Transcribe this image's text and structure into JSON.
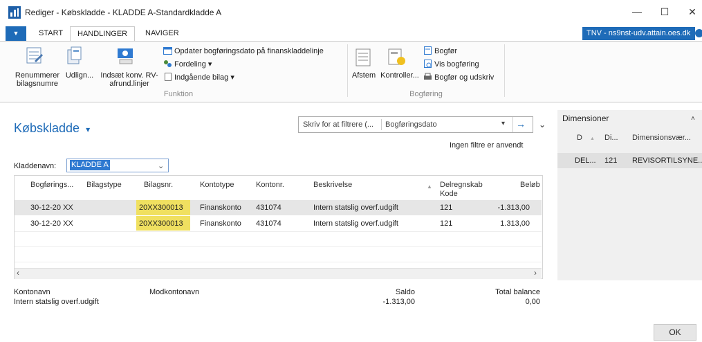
{
  "window": {
    "title": "Rediger - Købskladde - KLADDE A-Standardkladde A",
    "minimize": "—",
    "maximize": "☐",
    "close": "✕"
  },
  "ribbon": {
    "menu_icon": "▼",
    "tabs": [
      "START",
      "HANDLINGER",
      "NAVIGER"
    ],
    "server": "TNV - ns9nst-udv.attain.oes.dk",
    "funktion": {
      "label": "Funktion",
      "large_buttons": [
        {
          "label": "Renummerer bilagsnumre",
          "icon": "renumber-icon"
        },
        {
          "label": "Udlign...",
          "icon": "apply-entries-icon"
        },
        {
          "label": "Indsæt konv. RV-afrund.linjer",
          "icon": "insert-rounding-icon"
        }
      ],
      "small_buttons": [
        {
          "label": "Opdater bogføringsdato på finanskladdelinje",
          "icon": "update-date-icon"
        },
        {
          "label": "Fordeling ▾",
          "icon": "allocation-icon"
        },
        {
          "label": "Indgående bilag ▾",
          "icon": "incoming-document-icon"
        }
      ]
    },
    "bogforing": {
      "label": "Bogføring",
      "large_buttons": [
        {
          "label": "Afstem",
          "icon": "reconcile-icon"
        },
        {
          "label": "Kontroller...",
          "icon": "check-icon"
        }
      ],
      "small_buttons": [
        {
          "label": "Bogfør",
          "icon": "post-icon"
        },
        {
          "label": "Vis bogføring",
          "icon": "preview-posting-icon"
        },
        {
          "label": "Bogfør og udskriv",
          "icon": "post-print-icon"
        }
      ]
    }
  },
  "page": {
    "title": "Købskladde",
    "title_caret": "▾",
    "filter": {
      "placeholder": "Skriv for at filtrere (...",
      "field": "Bogføringsdato"
    },
    "no_filter": "Ingen filtre er anvendt",
    "kladdenavn_label": "Kladdenavn:",
    "kladdenavn_value": "KLADDE A"
  },
  "grid": {
    "columns": [
      "Bogførings...",
      "Bilagstype",
      "Bilagsnr.",
      "Kontotype",
      "Kontonr.",
      "Beskrivelse",
      "Delregnskab Kode",
      "Beløb"
    ],
    "rows": [
      {
        "date": "30-12-20 XX",
        "type": "",
        "docno": "20XX300013",
        "kontotype": "Finanskonto",
        "kontonr": "431074",
        "desc": "Intern statslig overf.udgift",
        "delregn": "121",
        "amount": "-1.313,00"
      },
      {
        "date": "30-12-20 XX",
        "type": "",
        "docno": "20XX300013",
        "kontotype": "Finanskonto",
        "kontonr": "431074",
        "desc": "Intern statslig overf.udgift",
        "delregn": "121",
        "amount": "1.313,00"
      }
    ]
  },
  "footer": {
    "kontonavn_label": "Kontonavn",
    "kontonavn_value": "Intern statslig overf.udgift",
    "modkontonavn_label": "Modkontonavn",
    "saldo_label": "Saldo",
    "saldo_value": "-1.313,00",
    "total_label": "Total balance",
    "total_value": "0,00"
  },
  "dimensions": {
    "title": "Dimensioner",
    "columns": [
      "D",
      "Di...",
      "Dimensionsvær..."
    ],
    "rows": [
      {
        "d": "DEL...",
        "di": "121",
        "value": "REVISORTILSYNE..."
      }
    ]
  },
  "ok_label": "OK",
  "colors": {
    "accent": "#1e6bb8",
    "highlight": "#f0e060",
    "selected_row": "#e6e6e6"
  }
}
